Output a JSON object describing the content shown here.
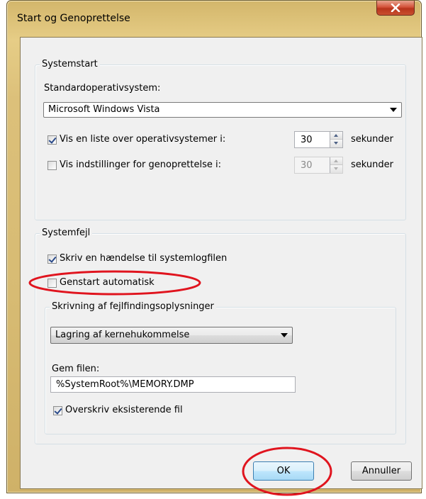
{
  "window": {
    "title": "Start og Genoprettelse",
    "close_icon": "close-x"
  },
  "startup": {
    "group_label": "Systemstart",
    "default_os_label": "Standardoperativsystem:",
    "default_os_value": "Microsoft Windows Vista",
    "show_os_list": {
      "label": "Vis en liste over operativsystemer i:",
      "checked": true,
      "value": "30",
      "unit": "sekunder"
    },
    "show_recovery": {
      "label": "Vis indstillinger for genoprettelse i:",
      "checked": false,
      "value": "30",
      "unit": "sekunder"
    }
  },
  "system_failure": {
    "group_label": "Systemfejl",
    "write_event": {
      "label": "Skriv en hændelse til systemlogfilen",
      "checked": true
    },
    "auto_restart": {
      "label": "Genstart automatisk",
      "checked": false
    },
    "debug_info": {
      "group_label": "Skrivning af fejlfindingsoplysninger",
      "dump_type": "Lagring af kernehukommelse",
      "dump_file_label": "Gem filen:",
      "dump_file_value": "%SystemRoot%\\MEMORY.DMP",
      "overwrite": {
        "label": "Overskriv eksisterende fil",
        "checked": true
      }
    }
  },
  "buttons": {
    "ok": "OK",
    "cancel": "Annuller"
  },
  "annotation_color": "#e0141e"
}
